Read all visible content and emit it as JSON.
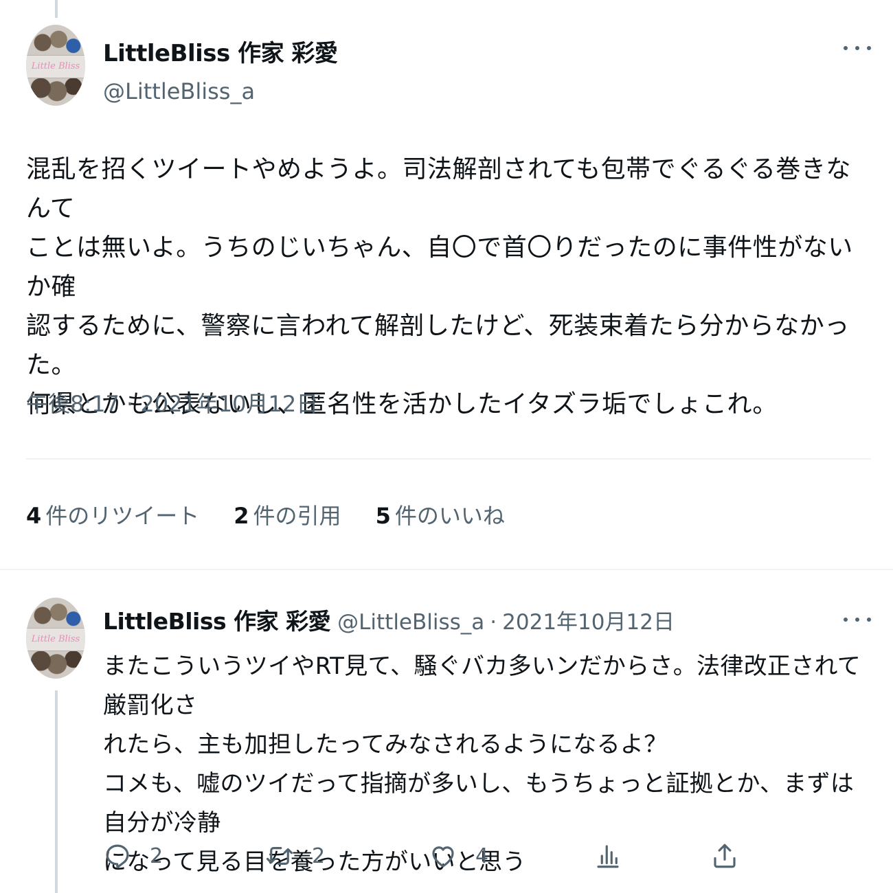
{
  "main_tweet": {
    "display_name": "LittleBliss 作家 彩愛",
    "handle": "@LittleBliss_a",
    "avatar_text": "Little Bliss",
    "text": "混乱を招くツイートやめようよ。司法解剖されても包帯でぐるぐる巻きなんて\nことは無いよ。うちのじいちゃん、自〇で首〇りだったのに事件性がないか確\n認するために、警察に言われて解剖したけど、死装束着たら分からなかった。\n何県とかも公表ないし、匿名性を活かしたイタズラ垢でしょこれ。",
    "timestamp": "午後8:17 · 2021年10月12日",
    "stats": {
      "retweets_count": "4",
      "retweets_label": "件のリツイート",
      "quotes_count": "2",
      "quotes_label": "件の引用",
      "likes_count": "5",
      "likes_label": "件のいいね"
    }
  },
  "reply": {
    "display_name": "LittleBliss 作家 彩愛",
    "handle": "@LittleBliss_a",
    "separator": "·",
    "date": "2021年10月12日",
    "avatar_text": "Little Bliss",
    "text": "またこういうツイやRT見て、騒ぐバカ多いンだからさ。法律改正されて厳罰化さ\nれたら、主も加担したってみなされるようになるよ？\nコメも、嘘のツイだって指摘が多いし、もうちょっと証拠とか、まずは自分が冷静\nになって見る目を養った方がいいと思う",
    "actions": {
      "reply_count": "2",
      "retweet_count": "2",
      "like_count": "4"
    }
  },
  "icons": {
    "more": "more-horizontal-icon",
    "reply": "reply-bubble-icon",
    "retweet": "retweet-icon",
    "like": "heart-icon",
    "analytics": "analytics-icon",
    "share": "share-icon"
  },
  "colors": {
    "text_primary": "#0f1419",
    "text_secondary": "#536471",
    "divider": "#eff3f4",
    "thread_line": "#cfd9de"
  }
}
